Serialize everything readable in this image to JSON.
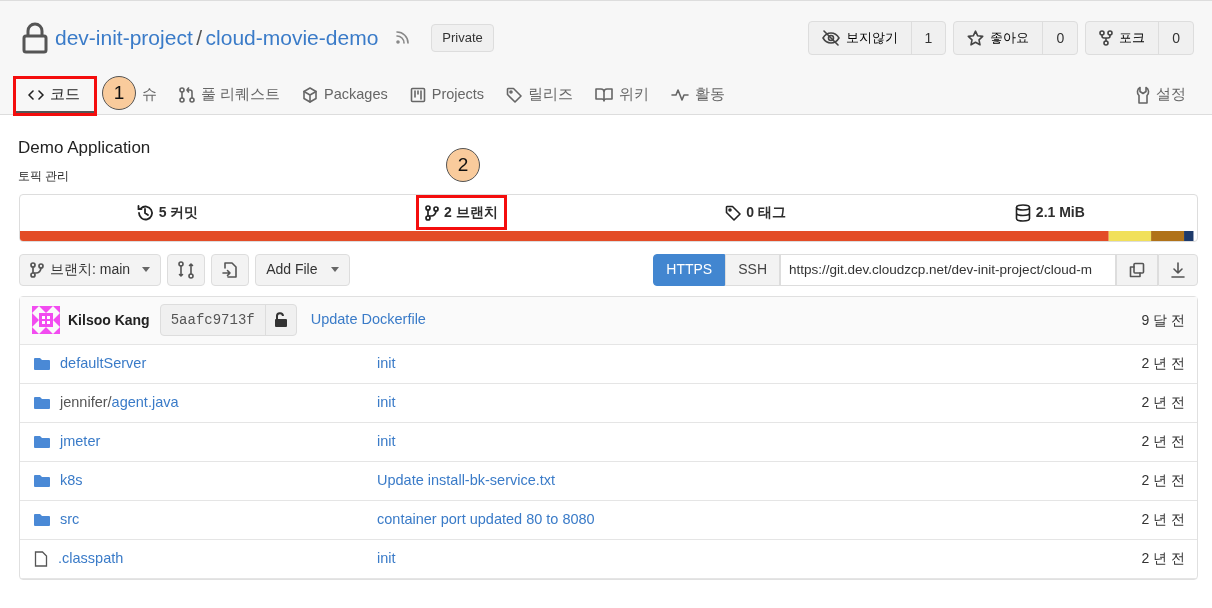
{
  "repo": {
    "namespace": "dev-init-project",
    "separator": "/",
    "name": "cloud-movie-demo",
    "visibility": "Private"
  },
  "actions": [
    {
      "kind": "watch",
      "label": "보지않기",
      "count": "1"
    },
    {
      "kind": "star",
      "label": "좋아요",
      "count": "0"
    },
    {
      "kind": "fork",
      "label": "포크",
      "count": "0"
    }
  ],
  "tabs": [
    {
      "kind": "code",
      "label": "코드",
      "selected": true,
      "highlighted": true
    },
    {
      "kind": "covered",
      "label": "슈",
      "selected": false,
      "highlighted": false
    },
    {
      "kind": "pr",
      "label": "풀 리퀘스트",
      "selected": false,
      "highlighted": false
    },
    {
      "kind": "package",
      "label": "Packages",
      "selected": false,
      "highlighted": false
    },
    {
      "kind": "board",
      "label": "Projects",
      "selected": false,
      "highlighted": false
    },
    {
      "kind": "tag",
      "label": "릴리즈",
      "selected": false,
      "highlighted": false
    },
    {
      "kind": "book",
      "label": "위키",
      "selected": false,
      "highlighted": false
    },
    {
      "kind": "pulse",
      "label": "활동",
      "selected": false,
      "highlighted": false
    }
  ],
  "settings_tab": {
    "label": "설정"
  },
  "description": "Demo Application",
  "topics_link": "토픽 관리",
  "stats": [
    {
      "kind": "history",
      "label": "5 커밋",
      "highlighted": false
    },
    {
      "kind": "branch",
      "label": "2 브랜치",
      "highlighted": true
    },
    {
      "kind": "tag",
      "label": "0 태그",
      "highlighted": false
    },
    {
      "kind": "db",
      "label": "2.1 MiB",
      "highlighted": false
    }
  ],
  "branch_select": {
    "label": "브랜치: main"
  },
  "add_file": {
    "label": "Add File"
  },
  "clone": {
    "protocols": [
      {
        "label": "HTTPS",
        "selected": true
      },
      {
        "label": "SSH",
        "selected": false
      }
    ],
    "url": "https://git.dev.cloudzcp.net/dev-init-project/cloud-m"
  },
  "last_commit": {
    "author": "Kilsoo Kang",
    "sha": "5aafc9713f",
    "message": "Update Dockerfile",
    "time": "9 달 전"
  },
  "files": [
    {
      "kind": "folder",
      "name": "defaultServer",
      "message": "init",
      "time": "2 년 전"
    },
    {
      "kind": "folder",
      "prefix": "jennifer/",
      "name": "agent.java",
      "message": "init",
      "time": "2 년 전"
    },
    {
      "kind": "folder",
      "name": "jmeter",
      "message": "init",
      "time": "2 년 전"
    },
    {
      "kind": "folder",
      "name": "k8s",
      "message": "Update install-bk-service.txt",
      "time": "2 년 전"
    },
    {
      "kind": "folder",
      "name": "src",
      "message": "container port updated 80 to 8080",
      "time": "2 년 전"
    },
    {
      "kind": "file",
      "name": ".classpath",
      "message": "init",
      "time": "2 년 전"
    }
  ],
  "annotations": [
    {
      "number": "1"
    },
    {
      "number": "2"
    }
  ]
}
